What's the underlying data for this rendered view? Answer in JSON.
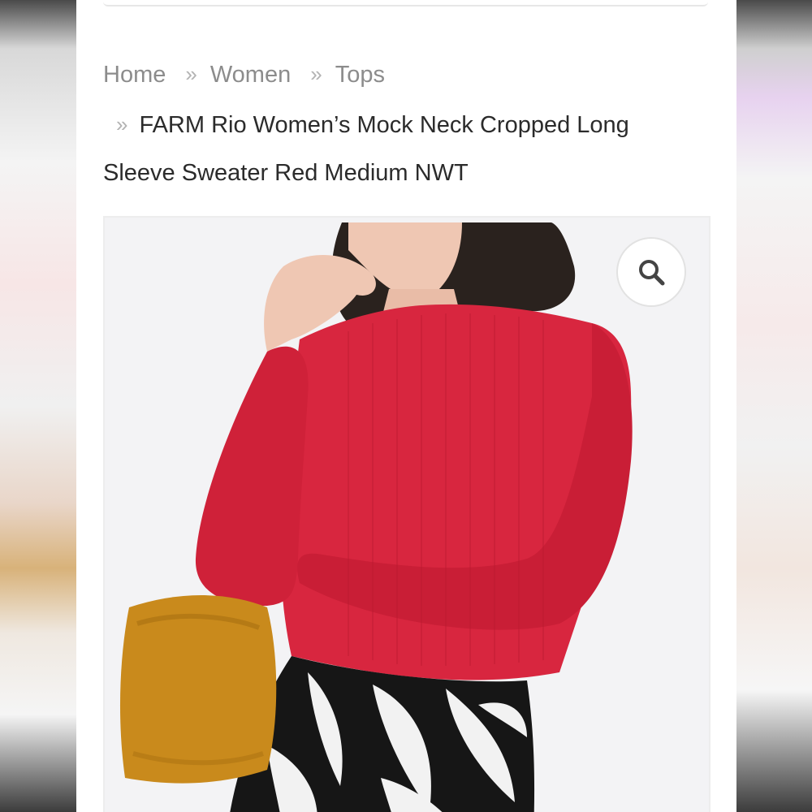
{
  "breadcrumb": {
    "items": [
      {
        "label": "Home"
      },
      {
        "label": "Women"
      },
      {
        "label": "Tops"
      }
    ],
    "separator": "»",
    "current_line1": "FARM Rio Women’s Mock Neck Cropped Long",
    "current_line2": "Sleeve Sweater Red Medium NWT"
  },
  "product_image": {
    "zoom_icon": "search-icon",
    "colors": {
      "sweater": "#d8263f",
      "bag": "#c98a1c",
      "skirt_dark": "#161616",
      "skirt_light": "#f2f2f2",
      "hair": "#2a221e",
      "skin": "#efc7b3",
      "background": "#f3f3f5"
    }
  }
}
